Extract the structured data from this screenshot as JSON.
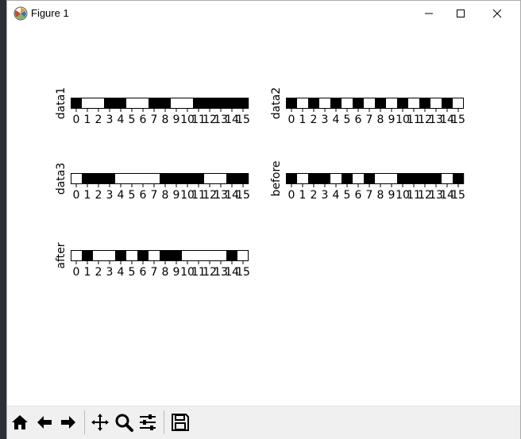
{
  "window": {
    "title": "Figure 1",
    "controls": {
      "minimize": "minimize",
      "maximize": "maximize",
      "close": "close"
    }
  },
  "chart_data": {
    "type": "heatmap",
    "colors": {
      "one": "#000000",
      "zero": "#ffffff"
    },
    "ticks": [
      "0",
      "1",
      "2",
      "3",
      "4",
      "5",
      "6",
      "7",
      "8",
      "9",
      "10",
      "11",
      "12",
      "13",
      "14",
      "15"
    ],
    "panels": [
      {
        "label": "data1",
        "values": [
          1,
          0,
          0,
          1,
          1,
          0,
          0,
          1,
          1,
          0,
          0,
          1,
          1,
          1,
          1,
          1
        ]
      },
      {
        "label": "data2",
        "values": [
          1,
          0,
          1,
          0,
          1,
          0,
          1,
          0,
          1,
          0,
          1,
          0,
          1,
          0,
          1,
          0
        ]
      },
      {
        "label": "data3",
        "values": [
          0,
          1,
          1,
          1,
          0,
          0,
          0,
          0,
          1,
          1,
          1,
          1,
          0,
          0,
          1,
          1
        ]
      },
      {
        "label": "before",
        "values": [
          1,
          0,
          1,
          1,
          0,
          1,
          0,
          1,
          0,
          0,
          1,
          1,
          1,
          1,
          0,
          1
        ]
      },
      {
        "label": "after",
        "values": [
          0,
          1,
          0,
          0,
          1,
          0,
          1,
          0,
          1,
          1,
          0,
          0,
          0,
          0,
          1,
          0
        ]
      }
    ]
  },
  "toolbar": {
    "buttons": [
      "home-icon",
      "back-arrow-icon",
      "forward-arrow-icon",
      "pan-icon",
      "zoom-icon",
      "configure-subplots-icon",
      "save-icon"
    ]
  }
}
